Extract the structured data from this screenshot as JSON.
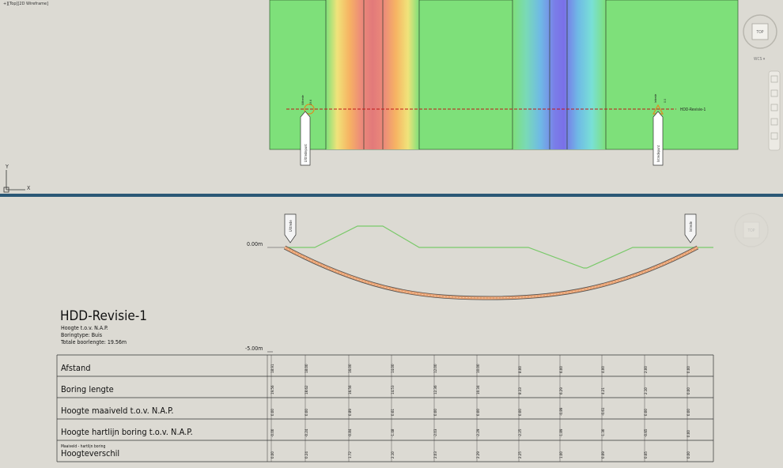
{
  "viewport_top": {
    "label": "+][Top][2D Wireframe]",
    "cube_face": "TOP",
    "wcs_label": "WCS ▾",
    "ucs_x": "X",
    "ucs_y": "Y",
    "plan_label": "HDD-Revisie-1",
    "entry_text": "Uittredepunt",
    "exit_text": "Intredepunt",
    "entry_small": "Uittrede",
    "exit_small": "Intrede",
    "small_vals": "19.6",
    "small_vals2": "0.0"
  },
  "viewport_bottom": {
    "cube_face": "TOP",
    "zero_label": "0.00m",
    "minus_label": "-5.00m",
    "entry_marker": "Uittrede",
    "exit_marker": "Intrede",
    "title": "HDD-Revisie-1",
    "info": [
      "Hoogte t.o.v. N.A.P.",
      "Boringtype: Buis",
      "Totale boorlengte: 19.56m"
    ],
    "table": {
      "rows": [
        {
          "label": "Afstand",
          "sub": "",
          "values": [
            "18.91",
            "18.00",
            "16.00",
            "14.00",
            "12.00",
            "10.00",
            "8.00",
            "6.00",
            "4.00",
            "2.00",
            "0.00"
          ]
        },
        {
          "label": "Boring lengte",
          "sub": "",
          "values": [
            "19.56",
            "18.62",
            "16.56",
            "14.53",
            "12.36",
            "10.34",
            "8.33",
            "6.29",
            "4.21",
            "2.10",
            "0.00"
          ]
        },
        {
          "label": "Hoogte maaiveld t.o.v. N.A.P.",
          "sub": "",
          "values": [
            "0.00",
            "0.00",
            "0.89",
            "0.61",
            "0.00",
            "0.00",
            "0.00",
            "-0.89",
            "-0.61",
            "0.00",
            "0.00"
          ]
        },
        {
          "label": "Hoogte hartlijn boring t.o.v. N.A.P.",
          "sub": "",
          "values": [
            "-0.00",
            "-0.24",
            "-0.84",
            "-1.48",
            "-2.03",
            "-2.29",
            "-2.25",
            "-1.89",
            "-1.30",
            "-0.65",
            "0.00"
          ]
        },
        {
          "label": "Hoogteverschil",
          "sub": "Maaiveld - hartlijn boring",
          "values": [
            "0.00",
            "0.24",
            "1.72",
            "2.10",
            "2.03",
            "2.29",
            "2.25",
            "1.00",
            "0.69",
            "0.65",
            "0.00"
          ]
        }
      ]
    }
  }
}
